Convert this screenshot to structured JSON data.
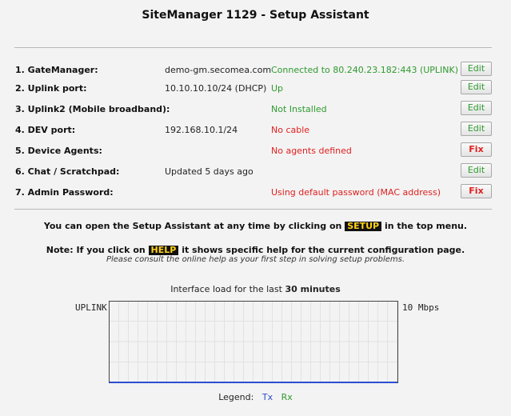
{
  "page": {
    "title": "SiteManager 1129 - Setup Assistant"
  },
  "rows": [
    {
      "label": "1. GateManager:",
      "value": "demo-gm.secomea.com",
      "status": "Connected to 80.240.23.182:443 (UPLINK)",
      "status_type": "ok",
      "button": "Edit"
    },
    {
      "label": "2. Uplink port:",
      "value": "10.10.10.10/24 (DHCP)",
      "status": "Up",
      "status_type": "ok",
      "button": "Edit"
    },
    {
      "label": "3. Uplink2 (Mobile broadband):",
      "value": "",
      "status": "Not Installed",
      "status_type": "ok",
      "button": "Edit"
    },
    {
      "label": "4. DEV port:",
      "value": "192.168.10.1/24",
      "status": "No cable",
      "status_type": "bad",
      "button": "Edit"
    },
    {
      "label": "5. Device Agents:",
      "value": "",
      "status": "No agents defined",
      "status_type": "bad",
      "button": "Fix"
    },
    {
      "label": "6. Chat / Scratchpad:",
      "value": "Updated 5 days ago",
      "status": "",
      "status_type": "ok",
      "button": "Edit"
    },
    {
      "label": "7. Admin Password:",
      "value": "",
      "status": "Using default password (MAC address)",
      "status_type": "bad",
      "button": "Fix"
    }
  ],
  "notes": {
    "line1_pre": "You can open the Setup Assistant at any time by clicking on",
    "line1_tag": "SETUP",
    "line1_post": "in the top menu.",
    "line2_pre": "Note: If you click on",
    "line2_tag": "HELP",
    "line2_post": "it shows specific help for the current configuration page.",
    "line3": "Please consult the online help as your first step in solving setup problems."
  },
  "chart": {
    "title_pre": "Interface load for the last",
    "title_bold": "30 minutes",
    "left_label": "UPLINK",
    "right_label": "10 Mbps",
    "legend_label": "Legend:",
    "legend_tx": "Tx",
    "legend_rx": "Rx"
  },
  "colors": {
    "ok": "#2e9a2e",
    "bad": "#e02020",
    "tx": "#2b4fd0",
    "rx": "#2e9a2e",
    "tag_bg": "#111111",
    "tag_fg": "#ffd21a"
  }
}
